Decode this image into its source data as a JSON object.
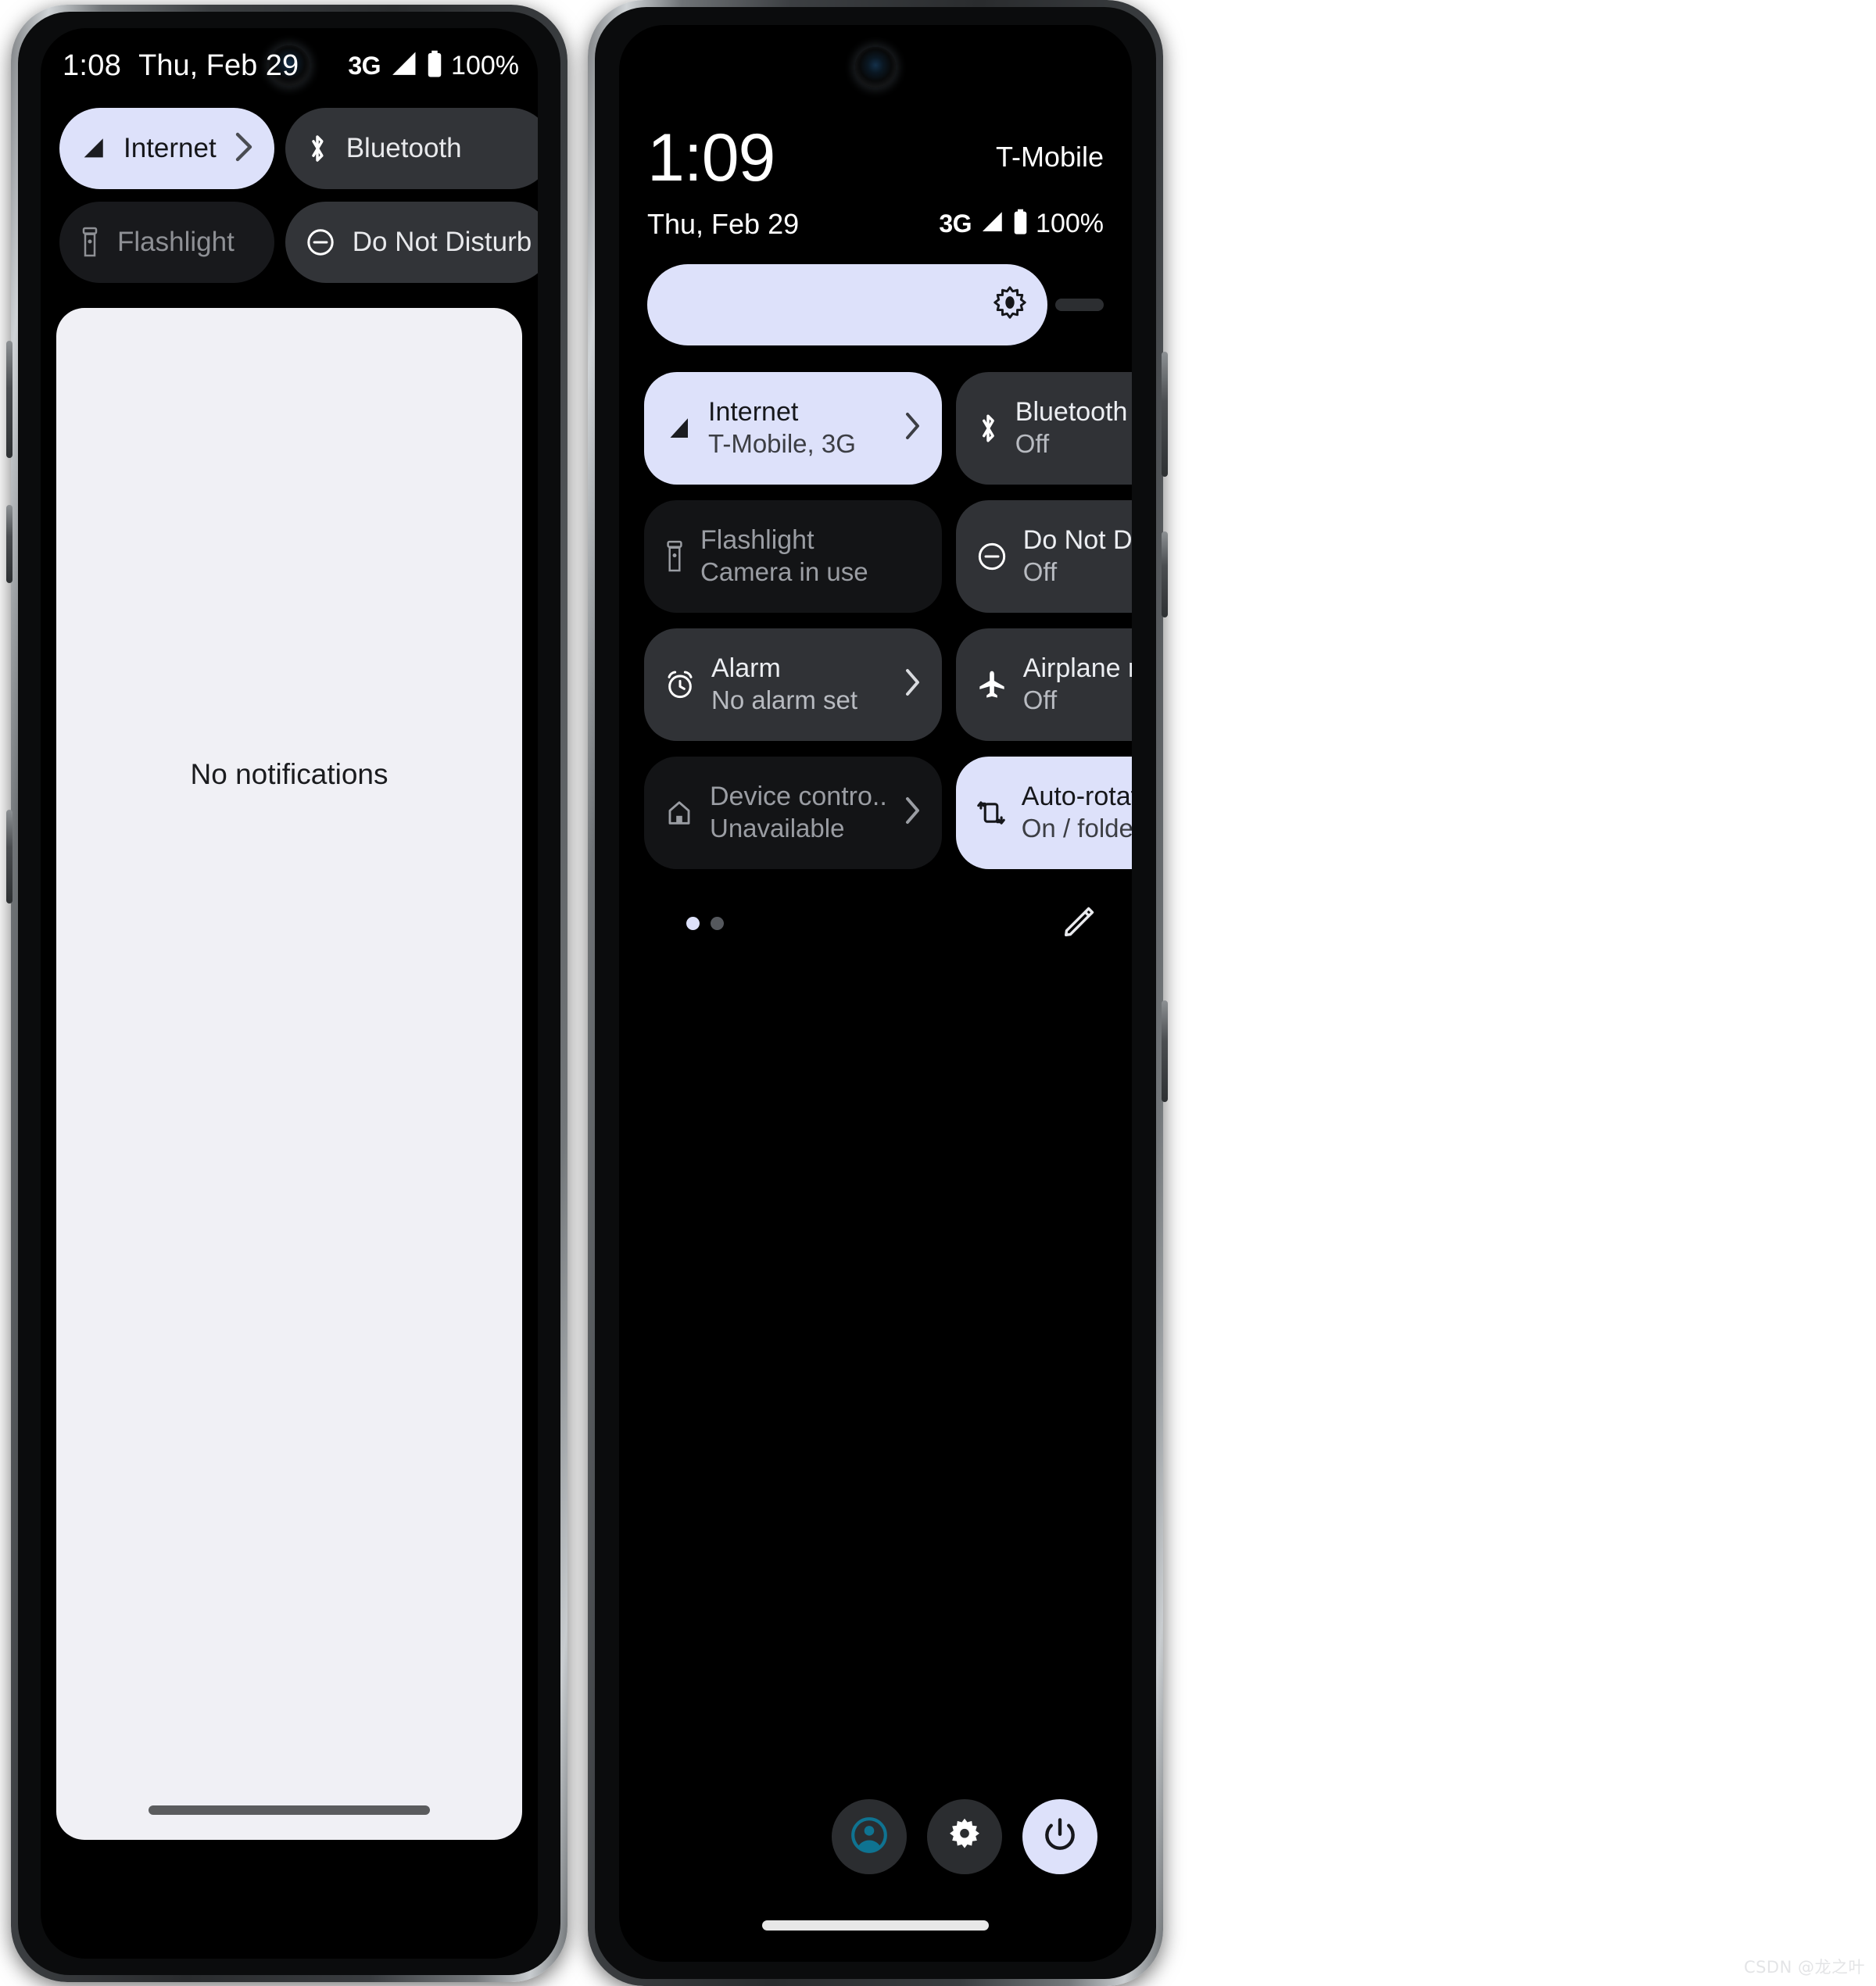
{
  "left_phone": {
    "status_bar": {
      "time": "1:08",
      "date": "Thu, Feb 29",
      "network": "3G",
      "battery_percent": "100%"
    },
    "quick_tiles": [
      {
        "label": "Internet",
        "icon": "signal-icon",
        "state": "on",
        "has_chevron": true
      },
      {
        "label": "Bluetooth",
        "icon": "bluetooth-icon",
        "state": "off",
        "has_chevron": false
      },
      {
        "label": "Flashlight",
        "icon": "flashlight-icon",
        "state": "disabled",
        "has_chevron": false
      },
      {
        "label": "Do Not Disturb",
        "icon": "dnd-icon",
        "state": "off",
        "has_chevron": false
      }
    ],
    "notifications": {
      "empty_text": "No notifications"
    }
  },
  "right_phone": {
    "header": {
      "clock": "1:09",
      "carrier": "T-Mobile",
      "date": "Thu, Feb 29",
      "network": "3G",
      "battery_percent": "100%"
    },
    "brightness": {
      "label": "brightness-slider",
      "icon": "brightness-icon",
      "level_percent": 92
    },
    "quick_tiles": [
      {
        "title": "Internet",
        "subtitle": "T-Mobile, 3G",
        "icon": "signal-icon",
        "state": "on",
        "has_chevron": true
      },
      {
        "title": "Bluetooth",
        "subtitle": "Off",
        "icon": "bluetooth-icon",
        "state": "off",
        "has_chevron": false
      },
      {
        "title": "Flashlight",
        "subtitle": "Camera in use",
        "icon": "flashlight-icon",
        "state": "disabled",
        "has_chevron": false
      },
      {
        "title": "Do Not Disturb",
        "subtitle": "Off",
        "icon": "dnd-icon",
        "state": "off",
        "has_chevron": false
      },
      {
        "title": "Alarm",
        "subtitle": "No alarm set",
        "icon": "alarm-icon",
        "state": "off",
        "has_chevron": true
      },
      {
        "title": "Airplane mode",
        "subtitle": "Off",
        "icon": "airplane-icon",
        "state": "off",
        "has_chevron": false
      },
      {
        "title": "Device contro..",
        "subtitle": "Unavailable",
        "icon": "home-icon",
        "state": "disabled",
        "has_chevron": true
      },
      {
        "title": "Auto-rotate",
        "subtitle": "On / folded",
        "icon": "autorotate-icon",
        "state": "on",
        "has_chevron": false
      }
    ],
    "pager": {
      "pages": 2,
      "active_page": 1
    },
    "edit_button": {
      "icon": "pencil-icon"
    },
    "bottom_buttons": [
      {
        "icon": "user-avatar-icon",
        "state": "normal"
      },
      {
        "icon": "gear-icon",
        "state": "normal"
      },
      {
        "icon": "power-icon",
        "state": "accent"
      }
    ]
  },
  "colors": {
    "accent": "#dde1fa",
    "tile_off": "#303236",
    "tile_disabled": "#131416",
    "panel_light": "#f0f0f5",
    "avatar_teal": "#0f7391"
  },
  "watermark": "CSDN @龙之叶"
}
